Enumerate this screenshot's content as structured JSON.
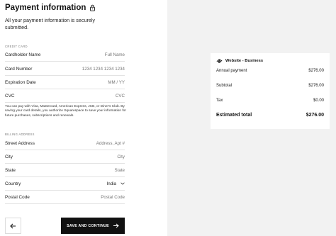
{
  "header": {
    "title": "Payment information",
    "subtitle": "All your payment information is securely submitted."
  },
  "credit_card": {
    "section_label": "CREDIT CARD",
    "fields": [
      {
        "label": "Cardholder Name",
        "placeholder": "Full Name"
      },
      {
        "label": "Card Number",
        "placeholder": "1234 1234 1234 1234"
      },
      {
        "label": "Expiration Date",
        "placeholder": "MM / YY"
      },
      {
        "label": "CVC",
        "placeholder": "CVC"
      }
    ],
    "note": "You can pay with Visa, Mastercard, American Express, JCB, or Diner's Club. By saving your card details, you authorize Squarespace to save your information for future purchases, subscriptions and renewals."
  },
  "billing": {
    "section_label": "BILLING ADDRESS",
    "street": {
      "label": "Street Address",
      "placeholder": "Address, Apt #"
    },
    "city": {
      "label": "City",
      "placeholder": "City"
    },
    "state": {
      "label": "State",
      "placeholder": "State"
    },
    "country": {
      "label": "Country",
      "value": "India"
    },
    "postal": {
      "label": "Postal Code",
      "placeholder": "Postal Code"
    }
  },
  "actions": {
    "save_label": "SAVE AND CONTINUE"
  },
  "summary": {
    "plan": "Website - Business",
    "annual_label": "Annual payment",
    "annual_value": "$276.00",
    "subtotal_label": "Subtotal",
    "subtotal_value": "$276.00",
    "tax_label": "Tax",
    "tax_value": "$0.00",
    "total_label": "Estimated total",
    "total_value": "$276.00"
  }
}
